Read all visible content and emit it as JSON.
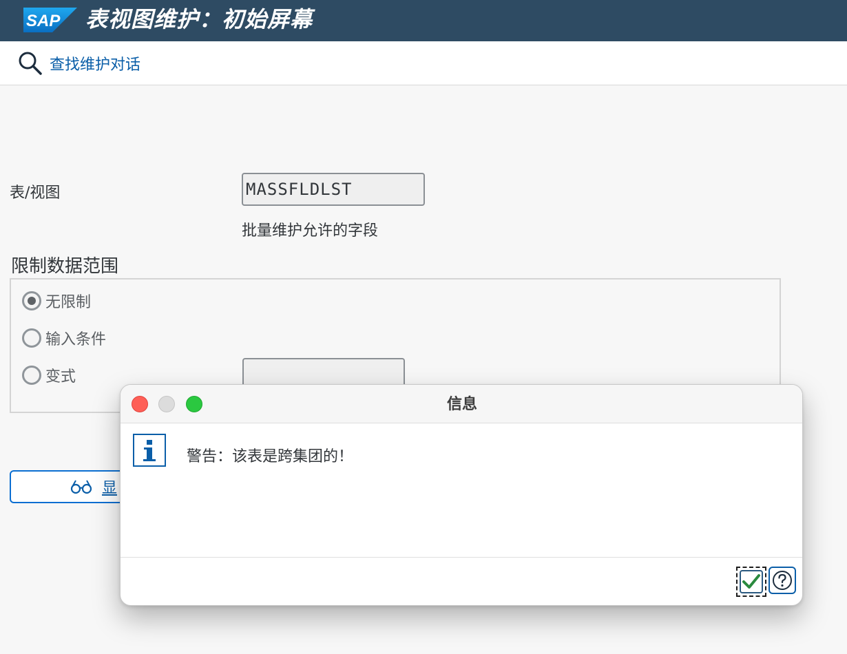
{
  "app": {
    "logo_text": "SAP",
    "title": "表视图维护：初始屏幕"
  },
  "toolbar": {
    "find_dialog_label": "查找维护对话"
  },
  "form": {
    "table_view_label": "表/视图",
    "table_view_value": "MASSFLDLST",
    "table_view_description": "批量维护允许的字段",
    "restrict_group_title": "限制数据范围",
    "options": [
      {
        "label": "无限制",
        "selected": true
      },
      {
        "label": "输入条件",
        "selected": false
      },
      {
        "label": "变式",
        "selected": false
      }
    ],
    "variant_value": "",
    "display_button_label": "显"
  },
  "dialog": {
    "title": "信息",
    "message": "警告：该表是跨集团的！"
  },
  "colors": {
    "titlebar": "#2e4b63",
    "link": "#0a5ea8",
    "ok_check": "#2a8a3e"
  }
}
